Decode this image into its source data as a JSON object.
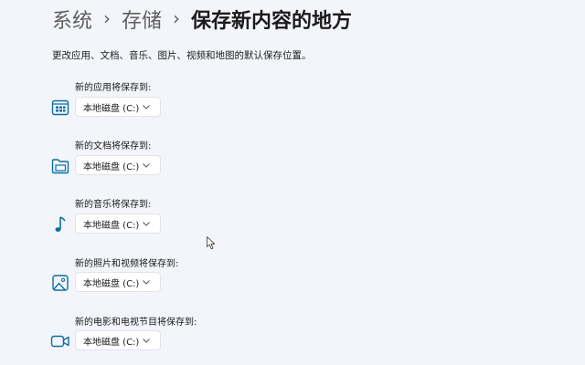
{
  "breadcrumb": {
    "items": [
      "系统",
      "存储"
    ],
    "separator": "›",
    "current": "保存新内容的地方"
  },
  "description": "更改应用、文档、音乐、图片、视频和地图的默认保存位置。",
  "icon_color": "#0b6fa4",
  "rows": [
    {
      "label": "新的应用将保存到:",
      "value": "本地磁盘 (C:)",
      "icon": "apps-icon"
    },
    {
      "label": "新的文档将保存到:",
      "value": "本地磁盘 (C:)",
      "icon": "folder-icon"
    },
    {
      "label": "新的音乐将保存到:",
      "value": "本地磁盘 (C:)",
      "icon": "music-note-icon"
    },
    {
      "label": "新的照片和视频将保存到:",
      "value": "本地磁盘 (C:)",
      "icon": "photo-icon"
    },
    {
      "label": "新的电影和电视节目将保存到:",
      "value": "本地磁盘 (C:)",
      "icon": "video-camera-icon"
    }
  ]
}
